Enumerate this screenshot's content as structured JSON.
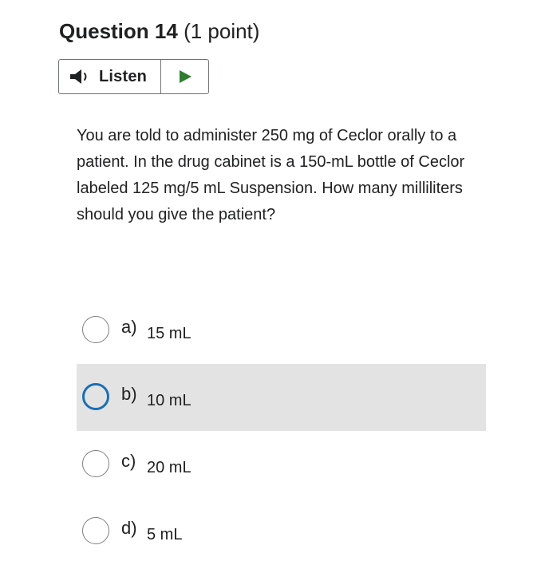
{
  "question": {
    "number_label": "Question 14",
    "points_label": "(1 point)"
  },
  "listen": {
    "label": "Listen",
    "speaker_icon": "speaker-icon",
    "play_icon": "play-icon",
    "accent_color": "#2e7d32"
  },
  "question_text": "You are told to administer 250 mg of Ceclor orally to a patient. In the drug cabinet is a 150-mL bottle of Ceclor labeled 125 mg/5 mL Suspension. How many milliliters should you give the patient?",
  "options": [
    {
      "letter": "a)",
      "text": "15 mL",
      "selected": false
    },
    {
      "letter": "b)",
      "text": "10 mL",
      "selected": true
    },
    {
      "letter": "c)",
      "text": "20 mL",
      "selected": false
    },
    {
      "letter": "d)",
      "text": "5 mL",
      "selected": false
    }
  ],
  "colors": {
    "selected_background": "#e3e3e3",
    "selected_radio": "#1a6fb3"
  }
}
